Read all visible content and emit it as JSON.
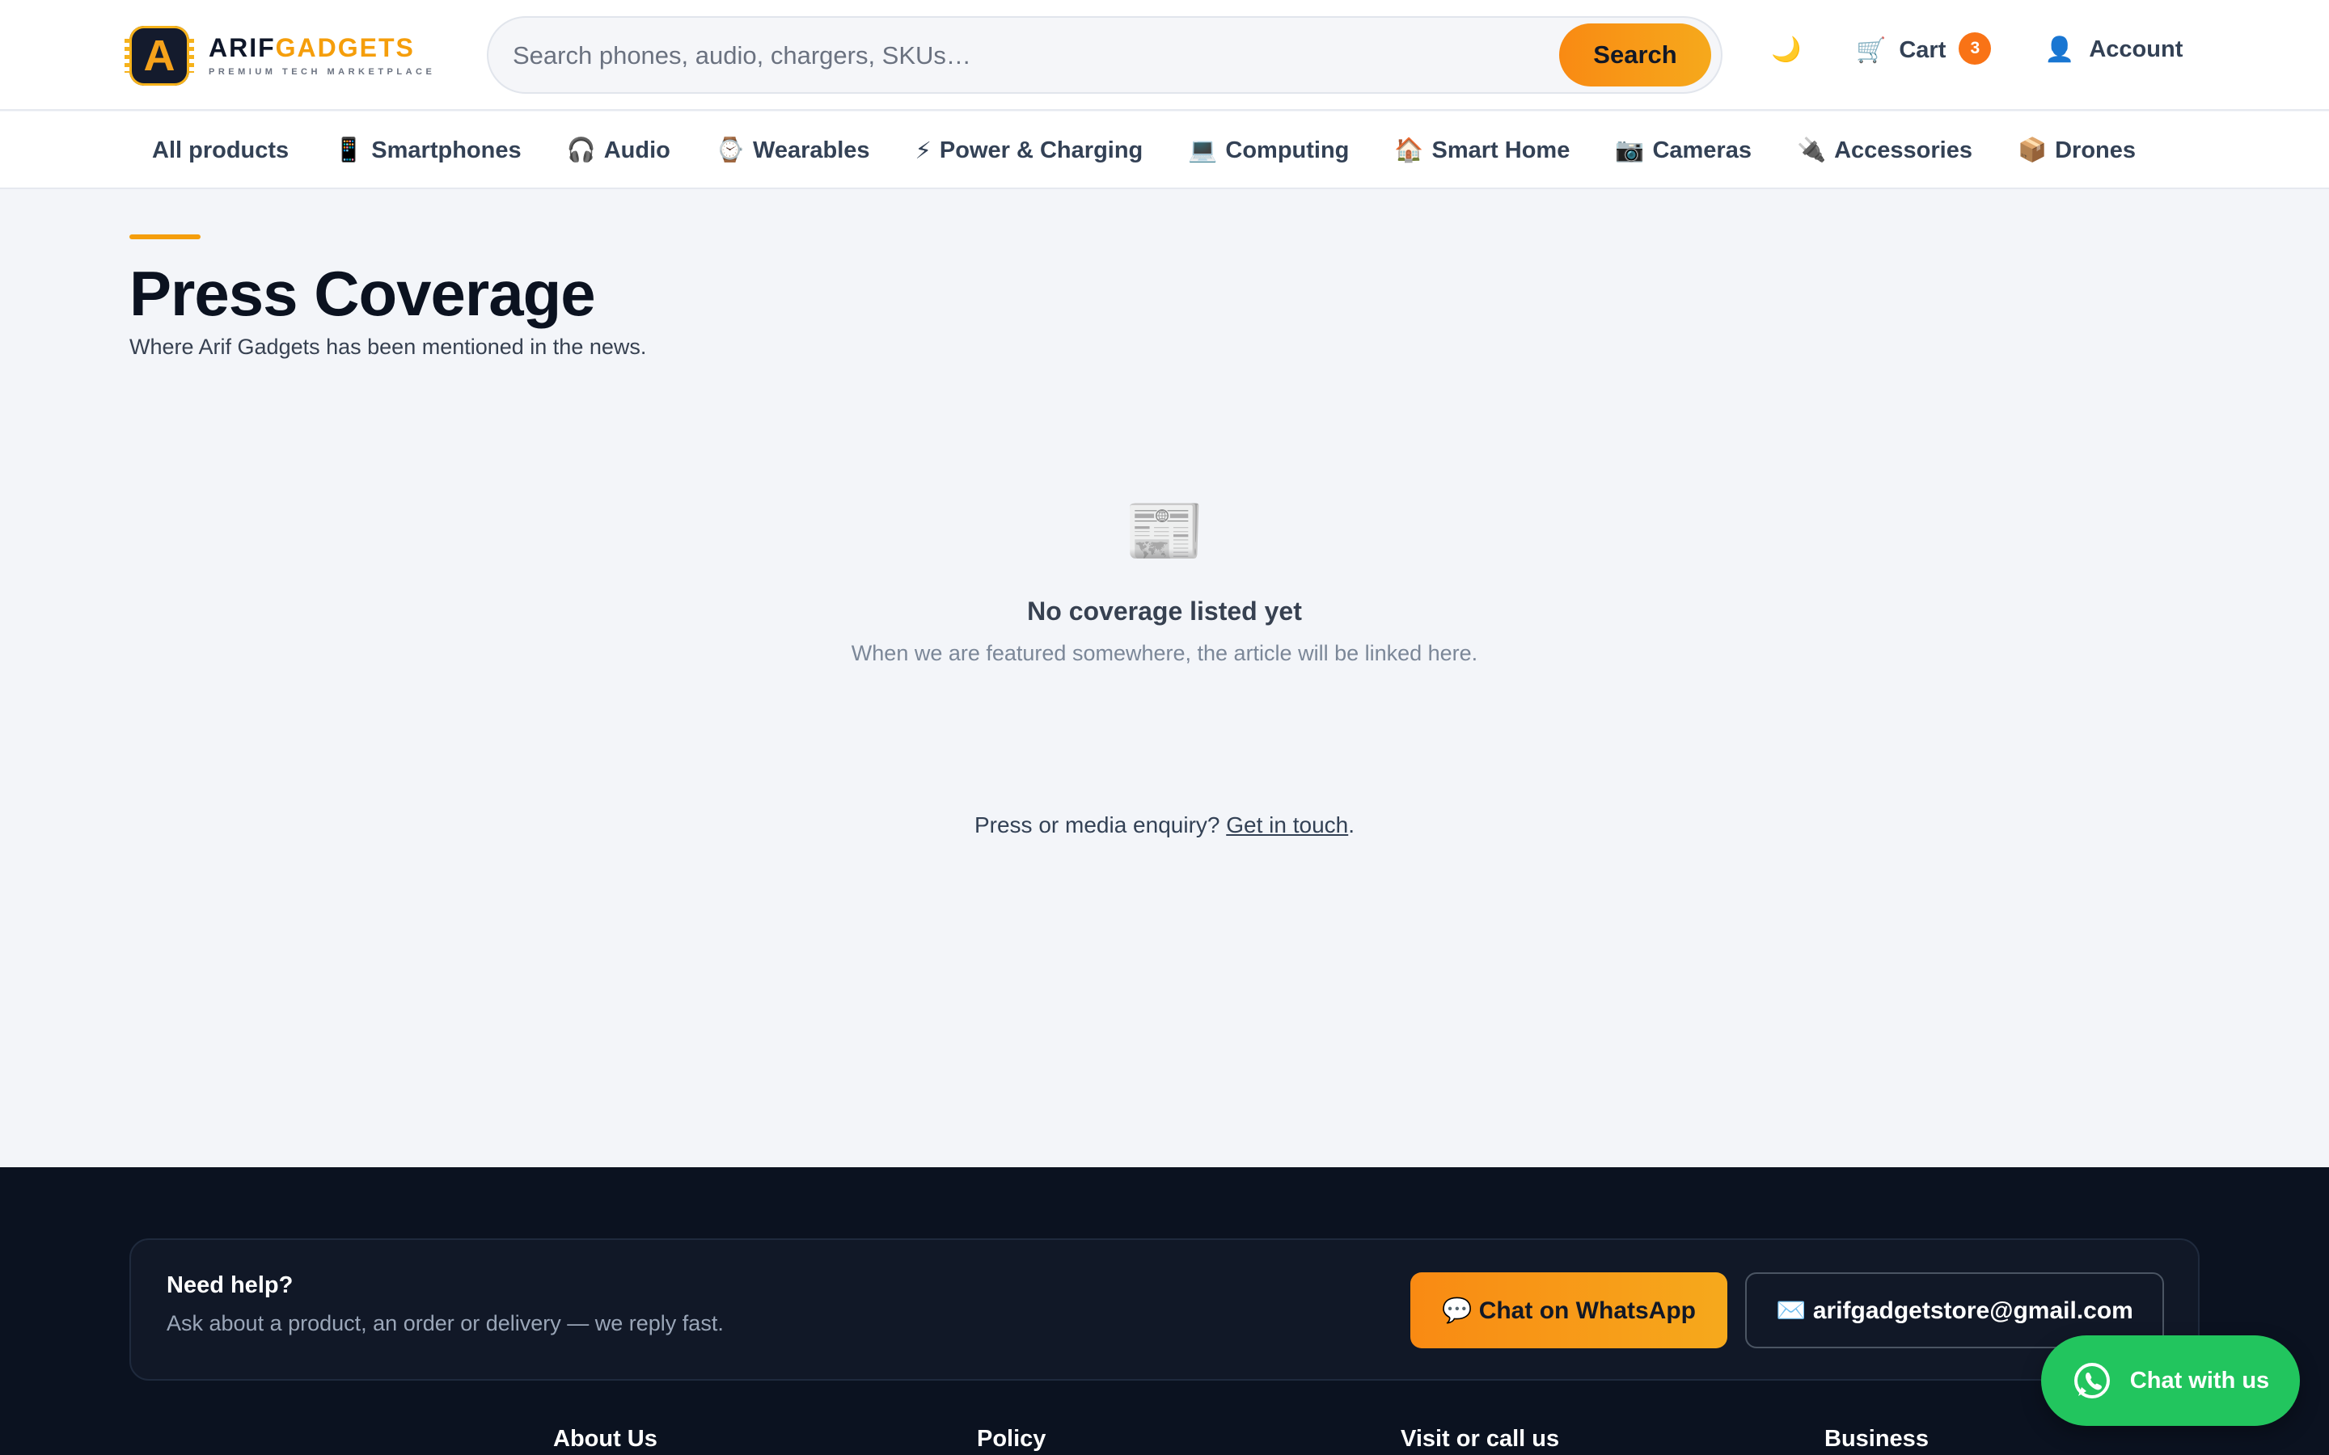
{
  "brand": {
    "logo_letter": "A",
    "name_part1": "ARIF",
    "name_part2": "GADGETS",
    "tagline": "PREMIUM TECH MARKETPLACE"
  },
  "search": {
    "placeholder": "Search phones, audio, chargers, SKUs…",
    "button_label": "Search"
  },
  "header": {
    "theme_icon": "🌙",
    "cart": {
      "icon": "🛒",
      "label": "Cart",
      "count": "3"
    },
    "account": {
      "icon": "👤",
      "label": "Account"
    }
  },
  "categories": [
    {
      "emoji": "",
      "label": "All products"
    },
    {
      "emoji": "📱",
      "label": "Smartphones"
    },
    {
      "emoji": "🎧",
      "label": "Audio"
    },
    {
      "emoji": "⌚",
      "label": "Wearables"
    },
    {
      "emoji": "⚡",
      "label": "Power & Charging"
    },
    {
      "emoji": "💻",
      "label": "Computing"
    },
    {
      "emoji": "🏠",
      "label": "Smart Home"
    },
    {
      "emoji": "📷",
      "label": "Cameras"
    },
    {
      "emoji": "🔌",
      "label": "Accessories"
    },
    {
      "emoji": "📦",
      "label": "Drones"
    }
  ],
  "page": {
    "title": "Press Coverage",
    "subtitle": "Where Arif Gadgets has been mentioned in the news."
  },
  "empty_state": {
    "icon": "📰",
    "title": "No coverage listed yet",
    "message": "When we are featured somewhere, the article will be linked here."
  },
  "enquiry": {
    "prefix": "Press or media enquiry?",
    "link_label": "Get in touch",
    "suffix": "."
  },
  "footer": {
    "help_title": "Need help?",
    "help_sub": "Ask about a product, an order or delivery — we reply fast.",
    "whatsapp_label": "💬 Chat on WhatsApp",
    "email_label": "✉️ arifgadgetstore@gmail.com",
    "columns": [
      "About Us",
      "Policy",
      "Visit or call us",
      "Business"
    ]
  },
  "chat_fab": {
    "label": "Chat with us"
  },
  "colors": {
    "accent": "#f59e0b",
    "accent_orange": "#f97316",
    "footer_bg": "#0b1220",
    "whatsapp_green": "#22c55e"
  }
}
